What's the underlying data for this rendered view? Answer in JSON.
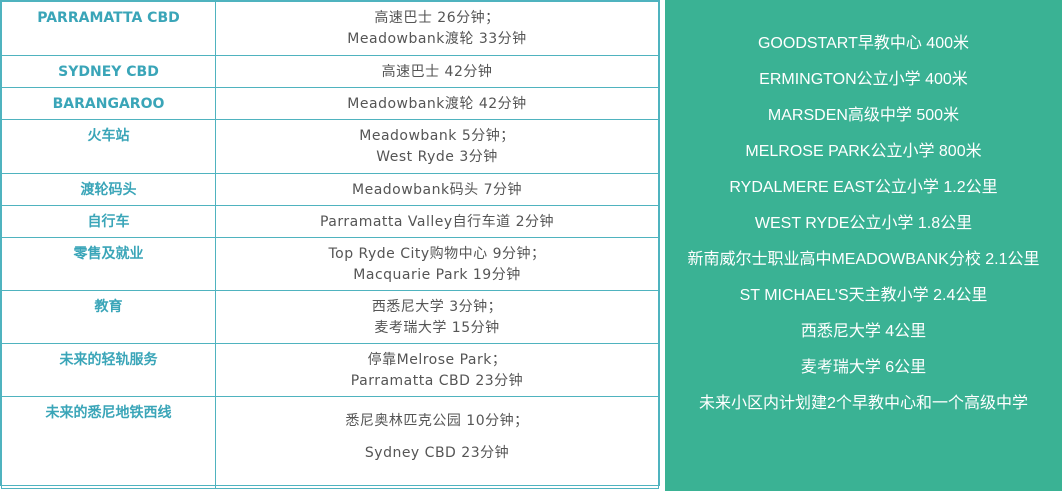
{
  "table": {
    "rows": [
      {
        "key": "PARRAMATTA CBD",
        "lines": [
          "高速巴士 26分钟；",
          "Meadowbank渡轮 33分钟"
        ]
      },
      {
        "key": "SYDNEY CBD",
        "lines": [
          "高速巴士 42分钟"
        ]
      },
      {
        "key": "BARANGAROO",
        "lines": [
          "Meadowbank渡轮 42分钟"
        ]
      },
      {
        "key": "火车站",
        "lines": [
          "Meadowbank 5分钟；",
          "West Ryde 3分钟"
        ]
      },
      {
        "key": "渡轮码头",
        "lines": [
          "Meadowbank码头 7分钟"
        ]
      },
      {
        "key": "自行车",
        "lines": [
          "Parramatta Valley自行车道 2分钟"
        ]
      },
      {
        "key": "零售及就业",
        "lines": [
          "Top Ryde City购物中心 9分钟；",
          "Macquarie Park 19分钟"
        ]
      },
      {
        "key": "教育",
        "lines": [
          "西悉尼大学 3分钟；",
          "麦考瑞大学 15分钟"
        ]
      },
      {
        "key": "未来的轻轨服务",
        "lines": [
          "停靠Melrose Park；",
          "Parramatta CBD 23分钟"
        ]
      },
      {
        "key": "未来的悉尼地铁西线",
        "lines": [
          "悉尼奥林匹克公园 10分钟；",
          "Sydney CBD 23分钟"
        ]
      }
    ]
  },
  "panel": {
    "items": [
      "GOODSTART早教中心 400米",
      "ERMINGTON公立小学 400米",
      "MARSDEN高级中学 500米",
      "MELROSE PARK公立小学 800米",
      "RYDALMERE EAST公立小学 1.2公里",
      "WEST RYDE公立小学 1.8公里",
      "新南威尔士职业高中MEADOWBANK分校 2.1公里",
      "ST MICHAEL’S天主教小学 2.4公里",
      "西悉尼大学 4公里",
      "麦考瑞大学 6公里",
      "未来小区内计划建2个早教中心和一个高级中学"
    ]
  }
}
